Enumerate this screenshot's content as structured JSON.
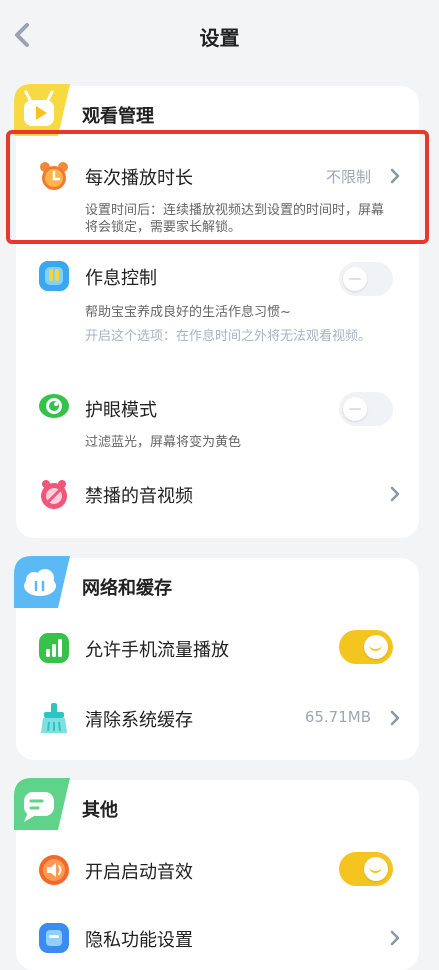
{
  "header": {
    "title": "设置"
  },
  "sections": {
    "watch": {
      "title": "观看管理",
      "items": [
        {
          "label": "每次播放时长",
          "value": "不限制",
          "desc": "设置时间后：连续播放视频达到设置的时间时，屏幕将会锁定，需要家长解锁。"
        },
        {
          "label": "作息控制",
          "desc": "帮助宝宝养成良好的生活作息习惯~",
          "note": "开启这个选项：在作息时间之外将无法观看视频。",
          "toggle": "off"
        },
        {
          "label": "护眼模式",
          "desc": "过滤蓝光，屏幕将变为黄色",
          "toggle": "off"
        },
        {
          "label": "禁播的音视频"
        }
      ]
    },
    "network": {
      "title": "网络和缓存",
      "items": [
        {
          "label": "允许手机流量播放",
          "toggle": "on"
        },
        {
          "label": "清除系统缓存",
          "value": "65.71MB"
        }
      ]
    },
    "other": {
      "title": "其他",
      "items": [
        {
          "label": "开启启动音效",
          "toggle": "on"
        },
        {
          "label": "隐私功能设置"
        }
      ]
    }
  },
  "colors": {
    "accent_yellow": "#f4c51f",
    "highlight_red": "#e8382b",
    "background": "#f3f4f6"
  }
}
